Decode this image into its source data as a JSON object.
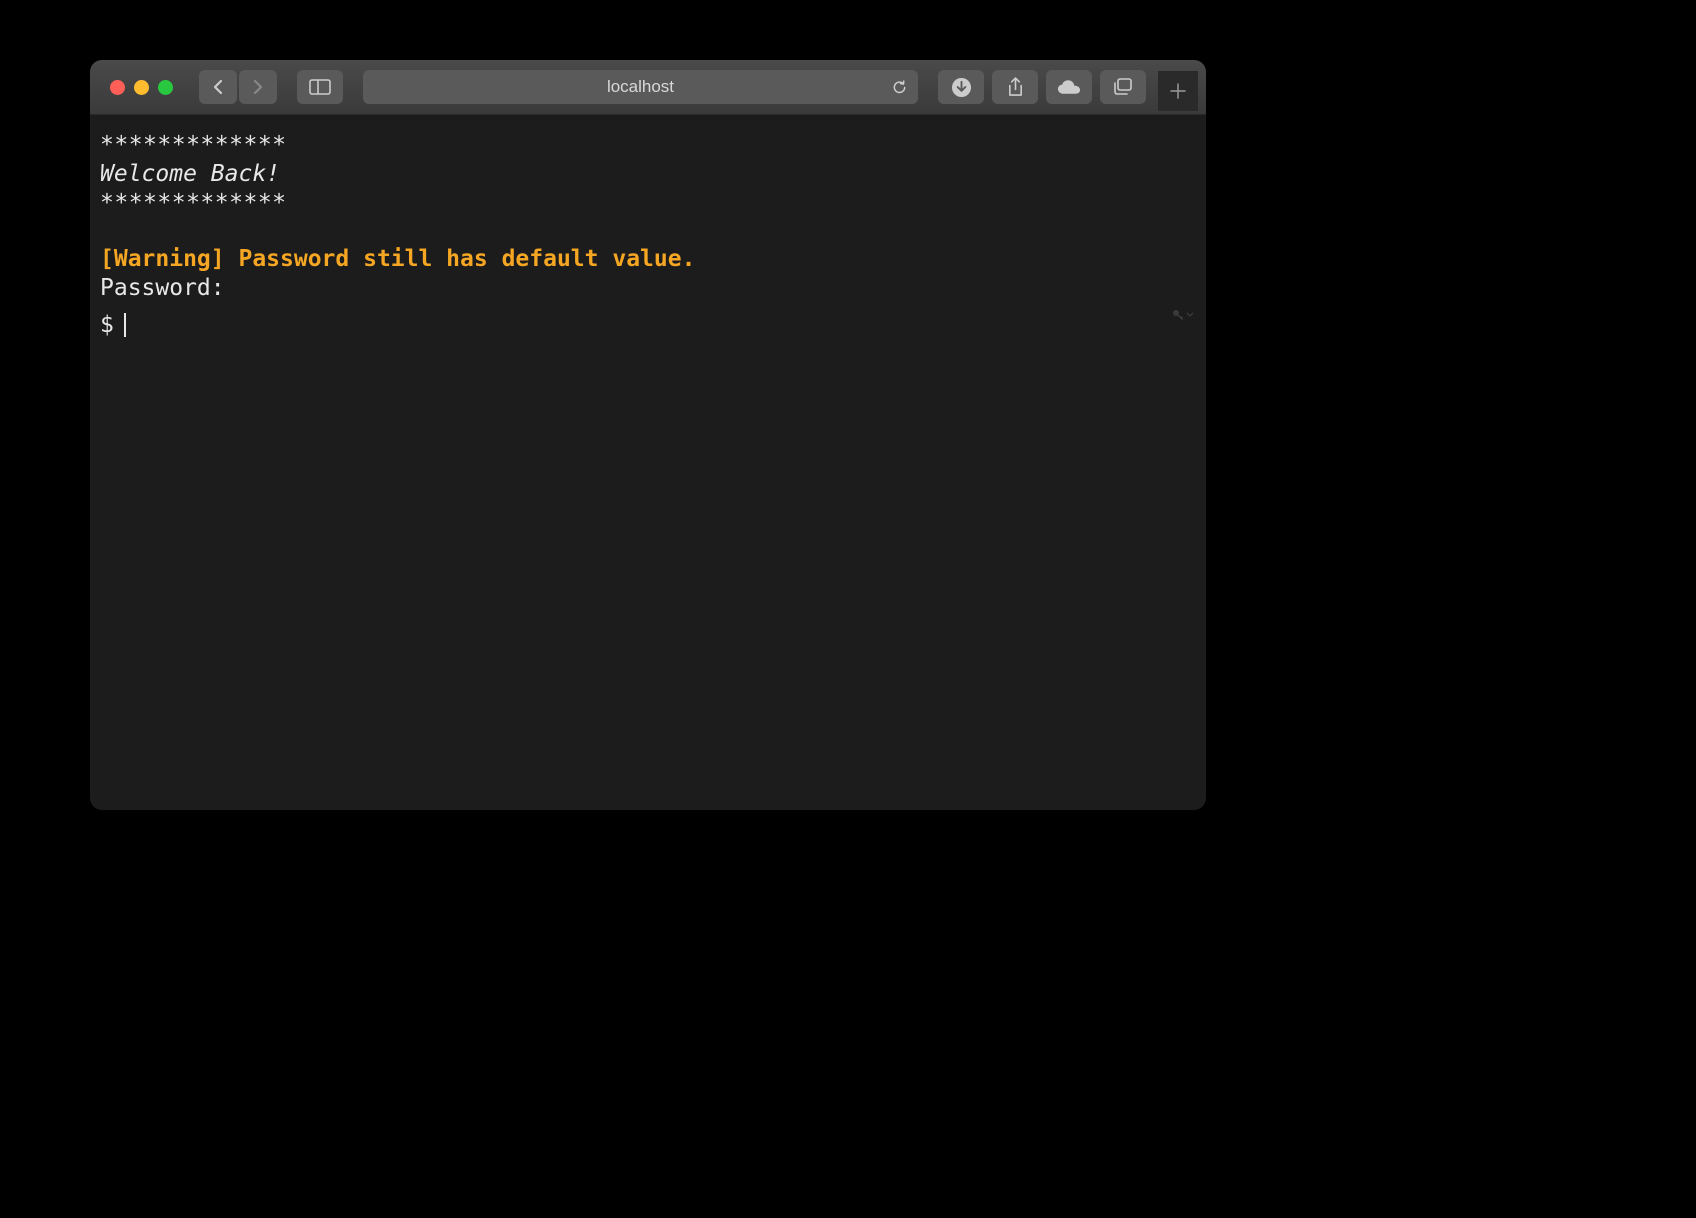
{
  "toolbar": {
    "address": "localhost"
  },
  "terminal": {
    "stars": "*************",
    "welcome": "Welcome Back!",
    "warning": "[Warning] Password still has default value.",
    "password_label": "Password:",
    "prompt": "$"
  }
}
